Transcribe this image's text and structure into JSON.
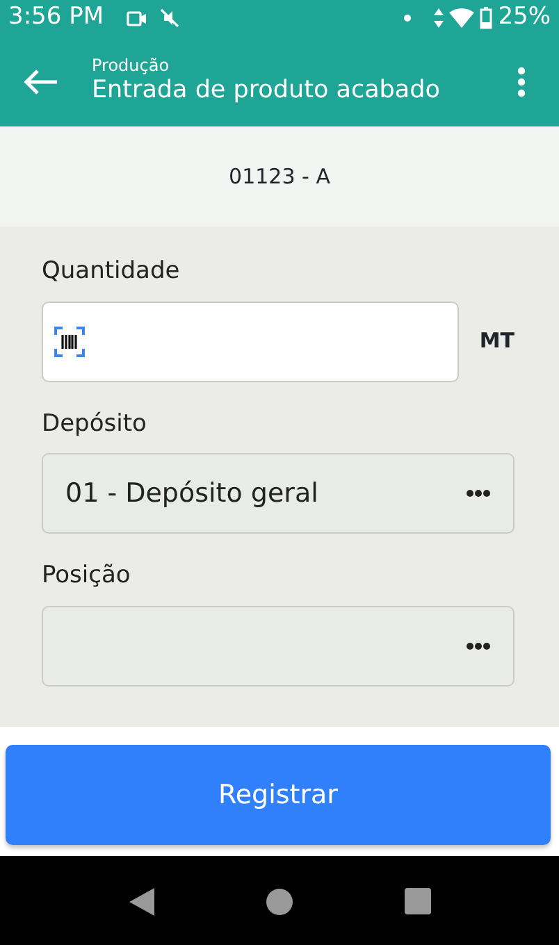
{
  "status_bar": {
    "time": "3:56 PM",
    "battery": "25%"
  },
  "app_bar": {
    "subtitle": "Produção",
    "title": "Entrada de produto acabado"
  },
  "product_code": "01123 - A",
  "fields": [
    {
      "kind": "scan",
      "label": "Quantidade",
      "unit": "MT"
    },
    {
      "kind": "picker",
      "label": "Depósito",
      "value": "01 - Depósito geral"
    },
    {
      "kind": "picker",
      "label": "Posição"
    }
  ],
  "submit_button": "Registrar"
}
